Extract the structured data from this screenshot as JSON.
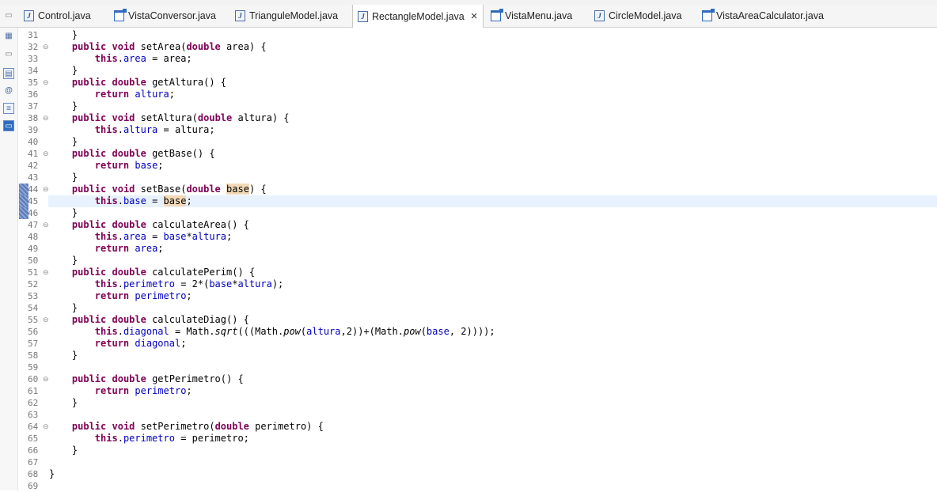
{
  "tabs": [
    {
      "label": "Control.java",
      "icon": "java-file-icon"
    },
    {
      "label": "VistaConversor.java",
      "icon": "java-class-icon"
    },
    {
      "label": "TrianguleModel.java",
      "icon": "java-file-icon"
    },
    {
      "label": "RectangleModel.java",
      "icon": "java-file-icon",
      "active": true
    },
    {
      "label": "VistaMenu.java",
      "icon": "java-class-icon"
    },
    {
      "label": "CircleModel.java",
      "icon": "java-file-icon"
    },
    {
      "label": "VistaAreaCalculator.java",
      "icon": "java-class-icon"
    }
  ],
  "close_glyph": "×",
  "editor": {
    "lines": [
      {
        "n": "31",
        "fold": false,
        "current": false,
        "tokens": [
          [
            "t",
            "    }"
          ]
        ]
      },
      {
        "n": "32",
        "fold": true,
        "current": false,
        "tokens": [
          [
            "t",
            "    "
          ],
          [
            "kw",
            "public"
          ],
          [
            "t",
            " "
          ],
          [
            "kw",
            "void"
          ],
          [
            "t",
            " setArea("
          ],
          [
            "kw",
            "double"
          ],
          [
            "t",
            " area) {"
          ]
        ]
      },
      {
        "n": "33",
        "fold": false,
        "current": false,
        "tokens": [
          [
            "t",
            "        "
          ],
          [
            "kw",
            "this"
          ],
          [
            "t",
            "."
          ],
          [
            "f",
            "area"
          ],
          [
            "t",
            " = area;"
          ]
        ]
      },
      {
        "n": "34",
        "fold": false,
        "current": false,
        "tokens": [
          [
            "t",
            "    }"
          ]
        ]
      },
      {
        "n": "35",
        "fold": true,
        "current": false,
        "tokens": [
          [
            "t",
            "    "
          ],
          [
            "kw",
            "public"
          ],
          [
            "t",
            " "
          ],
          [
            "kw",
            "double"
          ],
          [
            "t",
            " getAltura() {"
          ]
        ]
      },
      {
        "n": "36",
        "fold": false,
        "current": false,
        "tokens": [
          [
            "t",
            "        "
          ],
          [
            "kw",
            "return"
          ],
          [
            "t",
            " "
          ],
          [
            "f",
            "altura"
          ],
          [
            "t",
            ";"
          ]
        ]
      },
      {
        "n": "37",
        "fold": false,
        "current": false,
        "tokens": [
          [
            "t",
            "    }"
          ]
        ]
      },
      {
        "n": "38",
        "fold": true,
        "current": false,
        "tokens": [
          [
            "t",
            "    "
          ],
          [
            "kw",
            "public"
          ],
          [
            "t",
            " "
          ],
          [
            "kw",
            "void"
          ],
          [
            "t",
            " setAltura("
          ],
          [
            "kw",
            "double"
          ],
          [
            "t",
            " altura) {"
          ]
        ]
      },
      {
        "n": "39",
        "fold": false,
        "current": false,
        "tokens": [
          [
            "t",
            "        "
          ],
          [
            "kw",
            "this"
          ],
          [
            "t",
            "."
          ],
          [
            "f",
            "altura"
          ],
          [
            "t",
            " = altura;"
          ]
        ]
      },
      {
        "n": "40",
        "fold": false,
        "current": false,
        "tokens": [
          [
            "t",
            "    }"
          ]
        ]
      },
      {
        "n": "41",
        "fold": true,
        "current": false,
        "tokens": [
          [
            "t",
            "    "
          ],
          [
            "kw",
            "public"
          ],
          [
            "t",
            " "
          ],
          [
            "kw",
            "double"
          ],
          [
            "t",
            " getBase() {"
          ]
        ]
      },
      {
        "n": "42",
        "fold": false,
        "current": false,
        "tokens": [
          [
            "t",
            "        "
          ],
          [
            "kw",
            "return"
          ],
          [
            "t",
            " "
          ],
          [
            "f",
            "base"
          ],
          [
            "t",
            ";"
          ]
        ]
      },
      {
        "n": "43",
        "fold": false,
        "current": false,
        "tokens": [
          [
            "t",
            "    }"
          ]
        ]
      },
      {
        "n": "44",
        "fold": true,
        "current": false,
        "mark": true,
        "tokens": [
          [
            "t",
            "    "
          ],
          [
            "kw",
            "public"
          ],
          [
            "t",
            " "
          ],
          [
            "kw",
            "void"
          ],
          [
            "t",
            " setBase("
          ],
          [
            "kw",
            "double"
          ],
          [
            "t",
            " "
          ],
          [
            "hl",
            "base"
          ],
          [
            "t",
            ") {"
          ]
        ]
      },
      {
        "n": "45",
        "fold": false,
        "current": true,
        "mark": true,
        "tokens": [
          [
            "t",
            "        "
          ],
          [
            "kw",
            "this"
          ],
          [
            "t",
            "."
          ],
          [
            "f",
            "base"
          ],
          [
            "t",
            " = "
          ],
          [
            "hl",
            "base"
          ],
          [
            "t",
            ";"
          ]
        ]
      },
      {
        "n": "46",
        "fold": false,
        "current": false,
        "mark": true,
        "tokens": [
          [
            "t",
            "    }"
          ]
        ]
      },
      {
        "n": "47",
        "fold": true,
        "current": false,
        "tokens": [
          [
            "t",
            "    "
          ],
          [
            "kw",
            "public"
          ],
          [
            "t",
            " "
          ],
          [
            "kw",
            "double"
          ],
          [
            "t",
            " calculateArea() {"
          ]
        ]
      },
      {
        "n": "48",
        "fold": false,
        "current": false,
        "tokens": [
          [
            "t",
            "        "
          ],
          [
            "kw",
            "this"
          ],
          [
            "t",
            "."
          ],
          [
            "f",
            "area"
          ],
          [
            "t",
            " = "
          ],
          [
            "f",
            "base"
          ],
          [
            "t",
            "*"
          ],
          [
            "f",
            "altura"
          ],
          [
            "t",
            ";"
          ]
        ]
      },
      {
        "n": "49",
        "fold": false,
        "current": false,
        "tokens": [
          [
            "t",
            "        "
          ],
          [
            "kw",
            "return"
          ],
          [
            "t",
            " "
          ],
          [
            "f",
            "area"
          ],
          [
            "t",
            ";"
          ]
        ]
      },
      {
        "n": "50",
        "fold": false,
        "current": false,
        "tokens": [
          [
            "t",
            "    }"
          ]
        ]
      },
      {
        "n": "51",
        "fold": true,
        "current": false,
        "tokens": [
          [
            "t",
            "    "
          ],
          [
            "kw",
            "public"
          ],
          [
            "t",
            " "
          ],
          [
            "kw",
            "double"
          ],
          [
            "t",
            " calculatePerim() {"
          ]
        ]
      },
      {
        "n": "52",
        "fold": false,
        "current": false,
        "tokens": [
          [
            "t",
            "        "
          ],
          [
            "kw",
            "this"
          ],
          [
            "t",
            "."
          ],
          [
            "f",
            "perimetro"
          ],
          [
            "t",
            " = 2*("
          ],
          [
            "f",
            "base"
          ],
          [
            "t",
            "*"
          ],
          [
            "f",
            "altura"
          ],
          [
            "t",
            ");"
          ]
        ]
      },
      {
        "n": "53",
        "fold": false,
        "current": false,
        "tokens": [
          [
            "t",
            "        "
          ],
          [
            "kw",
            "return"
          ],
          [
            "t",
            " "
          ],
          [
            "f",
            "perimetro"
          ],
          [
            "t",
            ";"
          ]
        ]
      },
      {
        "n": "54",
        "fold": false,
        "current": false,
        "tokens": [
          [
            "t",
            "    }"
          ]
        ]
      },
      {
        "n": "55",
        "fold": true,
        "current": false,
        "tokens": [
          [
            "t",
            "    "
          ],
          [
            "kw",
            "public"
          ],
          [
            "t",
            " "
          ],
          [
            "kw",
            "double"
          ],
          [
            "t",
            " calculateDiag() {"
          ]
        ]
      },
      {
        "n": "56",
        "fold": false,
        "current": false,
        "tokens": [
          [
            "t",
            "        "
          ],
          [
            "kw",
            "this"
          ],
          [
            "t",
            "."
          ],
          [
            "f",
            "diagonal"
          ],
          [
            "t",
            " = Math."
          ],
          [
            "i",
            "sqrt"
          ],
          [
            "t",
            "(((Math."
          ],
          [
            "i",
            "pow"
          ],
          [
            "t",
            "("
          ],
          [
            "f",
            "altura"
          ],
          [
            "t",
            ",2))+(Math."
          ],
          [
            "i",
            "pow"
          ],
          [
            "t",
            "("
          ],
          [
            "f",
            "base"
          ],
          [
            "t",
            ", 2))));"
          ]
        ]
      },
      {
        "n": "57",
        "fold": false,
        "current": false,
        "tokens": [
          [
            "t",
            "        "
          ],
          [
            "kw",
            "return"
          ],
          [
            "t",
            " "
          ],
          [
            "f",
            "diagonal"
          ],
          [
            "t",
            ";"
          ]
        ]
      },
      {
        "n": "58",
        "fold": false,
        "current": false,
        "tokens": [
          [
            "t",
            "    }"
          ]
        ]
      },
      {
        "n": "59",
        "fold": false,
        "current": false,
        "tokens": []
      },
      {
        "n": "60",
        "fold": true,
        "current": false,
        "tokens": [
          [
            "t",
            "    "
          ],
          [
            "kw",
            "public"
          ],
          [
            "t",
            " "
          ],
          [
            "kw",
            "double"
          ],
          [
            "t",
            " getPerimetro() {"
          ]
        ]
      },
      {
        "n": "61",
        "fold": false,
        "current": false,
        "tokens": [
          [
            "t",
            "        "
          ],
          [
            "kw",
            "return"
          ],
          [
            "t",
            " "
          ],
          [
            "f",
            "perimetro"
          ],
          [
            "t",
            ";"
          ]
        ]
      },
      {
        "n": "62",
        "fold": false,
        "current": false,
        "tokens": [
          [
            "t",
            "    }"
          ]
        ]
      },
      {
        "n": "63",
        "fold": false,
        "current": false,
        "tokens": []
      },
      {
        "n": "64",
        "fold": true,
        "current": false,
        "tokens": [
          [
            "t",
            "    "
          ],
          [
            "kw",
            "public"
          ],
          [
            "t",
            " "
          ],
          [
            "kw",
            "void"
          ],
          [
            "t",
            " setPerimetro("
          ],
          [
            "kw",
            "double"
          ],
          [
            "t",
            " perimetro) {"
          ]
        ]
      },
      {
        "n": "65",
        "fold": false,
        "current": false,
        "tokens": [
          [
            "t",
            "        "
          ],
          [
            "kw",
            "this"
          ],
          [
            "t",
            "."
          ],
          [
            "f",
            "perimetro"
          ],
          [
            "t",
            " = perimetro;"
          ]
        ]
      },
      {
        "n": "66",
        "fold": false,
        "current": false,
        "tokens": [
          [
            "t",
            "    }"
          ]
        ]
      },
      {
        "n": "67",
        "fold": false,
        "current": false,
        "tokens": []
      },
      {
        "n": "68",
        "fold": false,
        "current": false,
        "tokens": [
          [
            "t",
            "}"
          ]
        ]
      },
      {
        "n": "69",
        "fold": false,
        "current": false,
        "tokens": []
      }
    ]
  },
  "colors": {
    "keyword": "#7f0055",
    "field": "#0000c0",
    "occurrence_highlight": "#f2d9b8",
    "current_line": "#e8f2fe"
  }
}
